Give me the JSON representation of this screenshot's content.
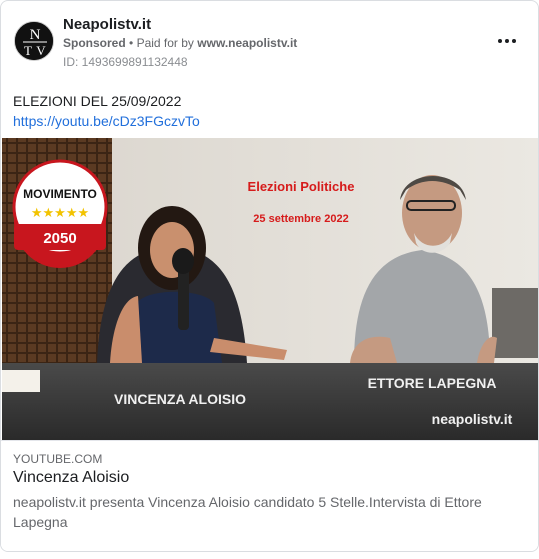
{
  "post": {
    "page_name": "Neapolistv.it",
    "sponsored": "Sponsored",
    "separator": "•",
    "paid_for_prefix": "Paid for by",
    "paid_for_by": "www.neapolistv.it",
    "ad_id": "ID: 1493699891132448",
    "avatar_letters": [
      "N",
      "T",
      "V"
    ],
    "more_icon": "ellipsis-horizontal-icon",
    "text": "ELEZIONI DEL 25/09/2022",
    "link_text": "https://youtu.be/cDz3FGczvTo"
  },
  "media": {
    "logo_top": "MOVIMENTO",
    "logo_stars": "★★★★★",
    "logo_bottom": "2050",
    "overlay_title": "Elezioni Politiche",
    "overlay_date": "25 settembre 2022",
    "name_left": "VINCENZA ALOISIO",
    "name_right": "ETTORE LAPEGNA",
    "watermark": "neapolistv.it",
    "colors": {
      "logo_red": "#c8161e",
      "logo_gold": "#f2c300",
      "title_red": "#d61b1b",
      "lower_third": "#3a3a3a"
    }
  },
  "preview": {
    "source": "YOUTUBE.COM",
    "title": "Vincenza Aloisio",
    "description": "neapolistv.it presenta Vincenza Aloisio candidato 5 Stelle.Intervista di Ettore Lapegna"
  },
  "colors": {
    "link": "#216fdb",
    "secondary_text": "#65676b"
  }
}
